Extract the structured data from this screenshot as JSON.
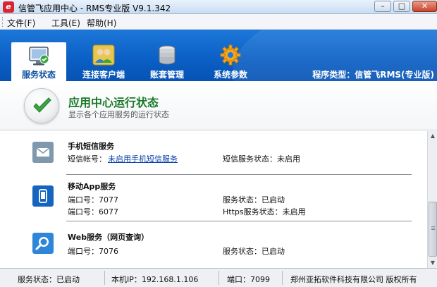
{
  "window": {
    "title": "信管飞应用中心 - RMS专业版 V9.1.342",
    "logo_text": "e",
    "minimize_glyph": "–",
    "maximize_glyph": "□",
    "close_glyph": "✕"
  },
  "menu": {
    "file": "文件(F)",
    "tools": "工具(E)",
    "help": "帮助(H)"
  },
  "toolbar": {
    "tabs": [
      {
        "label": "服务状态",
        "icon": "monitor-icon",
        "active": true
      },
      {
        "label": "连接客户端",
        "icon": "users-icon",
        "active": false
      },
      {
        "label": "账套管理",
        "icon": "database-icon",
        "active": false
      },
      {
        "label": "系统参数",
        "icon": "gear-icon",
        "active": false
      }
    ],
    "program_type": "程序类型：信管飞RMS(专业版)"
  },
  "header": {
    "title": "应用中心运行状态",
    "subtitle": "显示各个应用服务的运行状态",
    "icon": "check-icon"
  },
  "services": [
    {
      "name": "手机短信服务",
      "icon": "envelope-icon",
      "left_label": "短信帐号：",
      "left_link": "未启用手机短信服务",
      "right": "短信服务状态：未启用"
    },
    {
      "name": "移动App服务",
      "icon": "mobile-icon",
      "port1": "端口号：7077",
      "status1": "服务状态：已启动",
      "port2": "端口号：6077",
      "status2": "Https服务状态：未启用"
    },
    {
      "name": "Web服务（网页查询）",
      "icon": "magnifier-icon",
      "port1": "端口号：7076",
      "status1": "服务状态：已启动"
    }
  ],
  "statusbar": {
    "service_status": "服务状态：已启动",
    "ip": "本机IP：192.168.1.106",
    "port": "端口：7099",
    "company": "郑州亚拓软件科技有限公司 版权所有"
  },
  "colors": {
    "toolbar_blue": "#0a5ec4",
    "header_green": "#1a7a2a",
    "link_blue": "#0a3fa8",
    "close_red": "#c9432b"
  }
}
